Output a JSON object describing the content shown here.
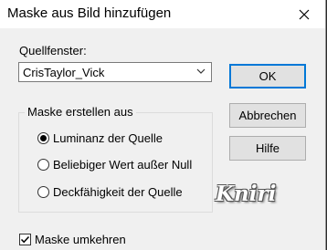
{
  "window": {
    "title": "Maske aus Bild hinzufügen"
  },
  "source": {
    "label": "Quellfenster:",
    "selected": "CrisTaylor_Vick"
  },
  "buttons": {
    "ok": "OK",
    "cancel": "Abbrechen",
    "help": "Hilfe"
  },
  "mask_group": {
    "legend": "Maske erstellen aus",
    "options": [
      {
        "label": "Luminanz der Quelle",
        "selected": true
      },
      {
        "label": "Beliebiger Wert außer Null",
        "selected": false
      },
      {
        "label": "Deckfähigkeit der Quelle",
        "selected": false
      }
    ]
  },
  "watermark": "Kniri",
  "invert": {
    "label": "Maske umkehren",
    "checked": true
  },
  "colors": {
    "ok_focus": "#0078d7",
    "dialog_bg": "#f0f0f0"
  }
}
